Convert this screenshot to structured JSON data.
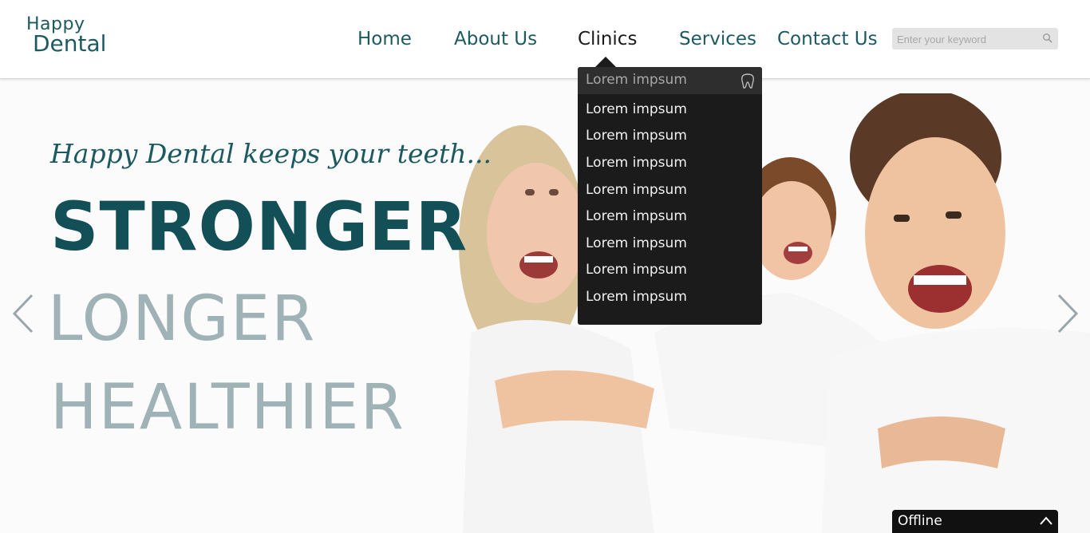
{
  "logo": {
    "line1": "Happy",
    "line2": "Dental"
  },
  "nav": {
    "items": [
      {
        "label": "Home"
      },
      {
        "label": "About Us"
      },
      {
        "label": "Clinics"
      },
      {
        "label": "Services"
      },
      {
        "label": "Contact Us"
      }
    ],
    "active": "Clinics"
  },
  "search": {
    "placeholder": "Enter your keyword",
    "value": ""
  },
  "dropdown": {
    "items": [
      "Lorem impsum",
      "Lorem impsum",
      "Lorem impsum",
      "Lorem impsum",
      "Lorem impsum",
      "Lorem impsum",
      "Lorem impsum",
      "Lorem impsum",
      "Lorem impsum"
    ]
  },
  "hero": {
    "tagline": "Happy Dental keeps your teeth...",
    "word1": "STRONGER",
    "word2": "LONGER",
    "word3": "HEALTHIER"
  },
  "chat": {
    "status": "Offline"
  },
  "colors": {
    "brand": "#1c5a60",
    "muted": "#9fb2b5",
    "dropdown_bg": "#1b1b1b"
  }
}
